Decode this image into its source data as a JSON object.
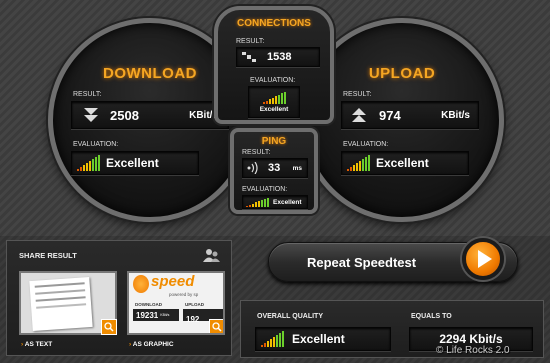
{
  "connections": {
    "title": "CONNECTIONS",
    "result_label": "RESULT:",
    "result_value": "1538",
    "evaluation_label": "EVALUATION:",
    "evaluation_value": "Excellent",
    "signal_level": 1.0
  },
  "download": {
    "title": "DOWNLOAD",
    "result_label": "RESULT:",
    "value": "2508",
    "unit": "KBit/s",
    "evaluation_label": "EVALUATION:",
    "evaluation_value": "Excellent",
    "signal_level": 1.0
  },
  "upload": {
    "title": "UPLOAD",
    "result_label": "RESULT:",
    "value": "974",
    "unit": "KBit/s",
    "evaluation_label": "EVALUATION:",
    "evaluation_value": "Excellent",
    "signal_level": 1.0
  },
  "ping": {
    "title": "PING",
    "result_label": "RESULT:",
    "value": "33",
    "unit": "ms",
    "evaluation_label": "EVALUATION:",
    "evaluation_value": "Excellent",
    "signal_level": 1.0
  },
  "share": {
    "title": "SHARE RESULT",
    "as_text_label": "AS TEXT",
    "as_graphic_label": "AS GRAPHIC",
    "graphic_logo": "speed",
    "graphic_tagline": "powered by sp",
    "graphic_download_label": "DOWNLOAD",
    "graphic_upload_label": "UPLOAD",
    "graphic_download_value": "19231",
    "graphic_upload_value": "192",
    "graphic_unit": "KBit/s"
  },
  "repeat": {
    "label": "Repeat Speedtest"
  },
  "summary": {
    "overall_label": "OVERALL QUALITY",
    "overall_value": "Excellent",
    "equals_label": "EQUALS TO",
    "equals_value": "2294 Kbit/s",
    "signal_level": 1.0
  },
  "watermark": "© Life Rocks 2.0",
  "colors": {
    "accent": "#f5a623",
    "signal_low": "#e05a00",
    "signal_mid": "#f0c000",
    "signal_high": "#6ccf2c"
  }
}
